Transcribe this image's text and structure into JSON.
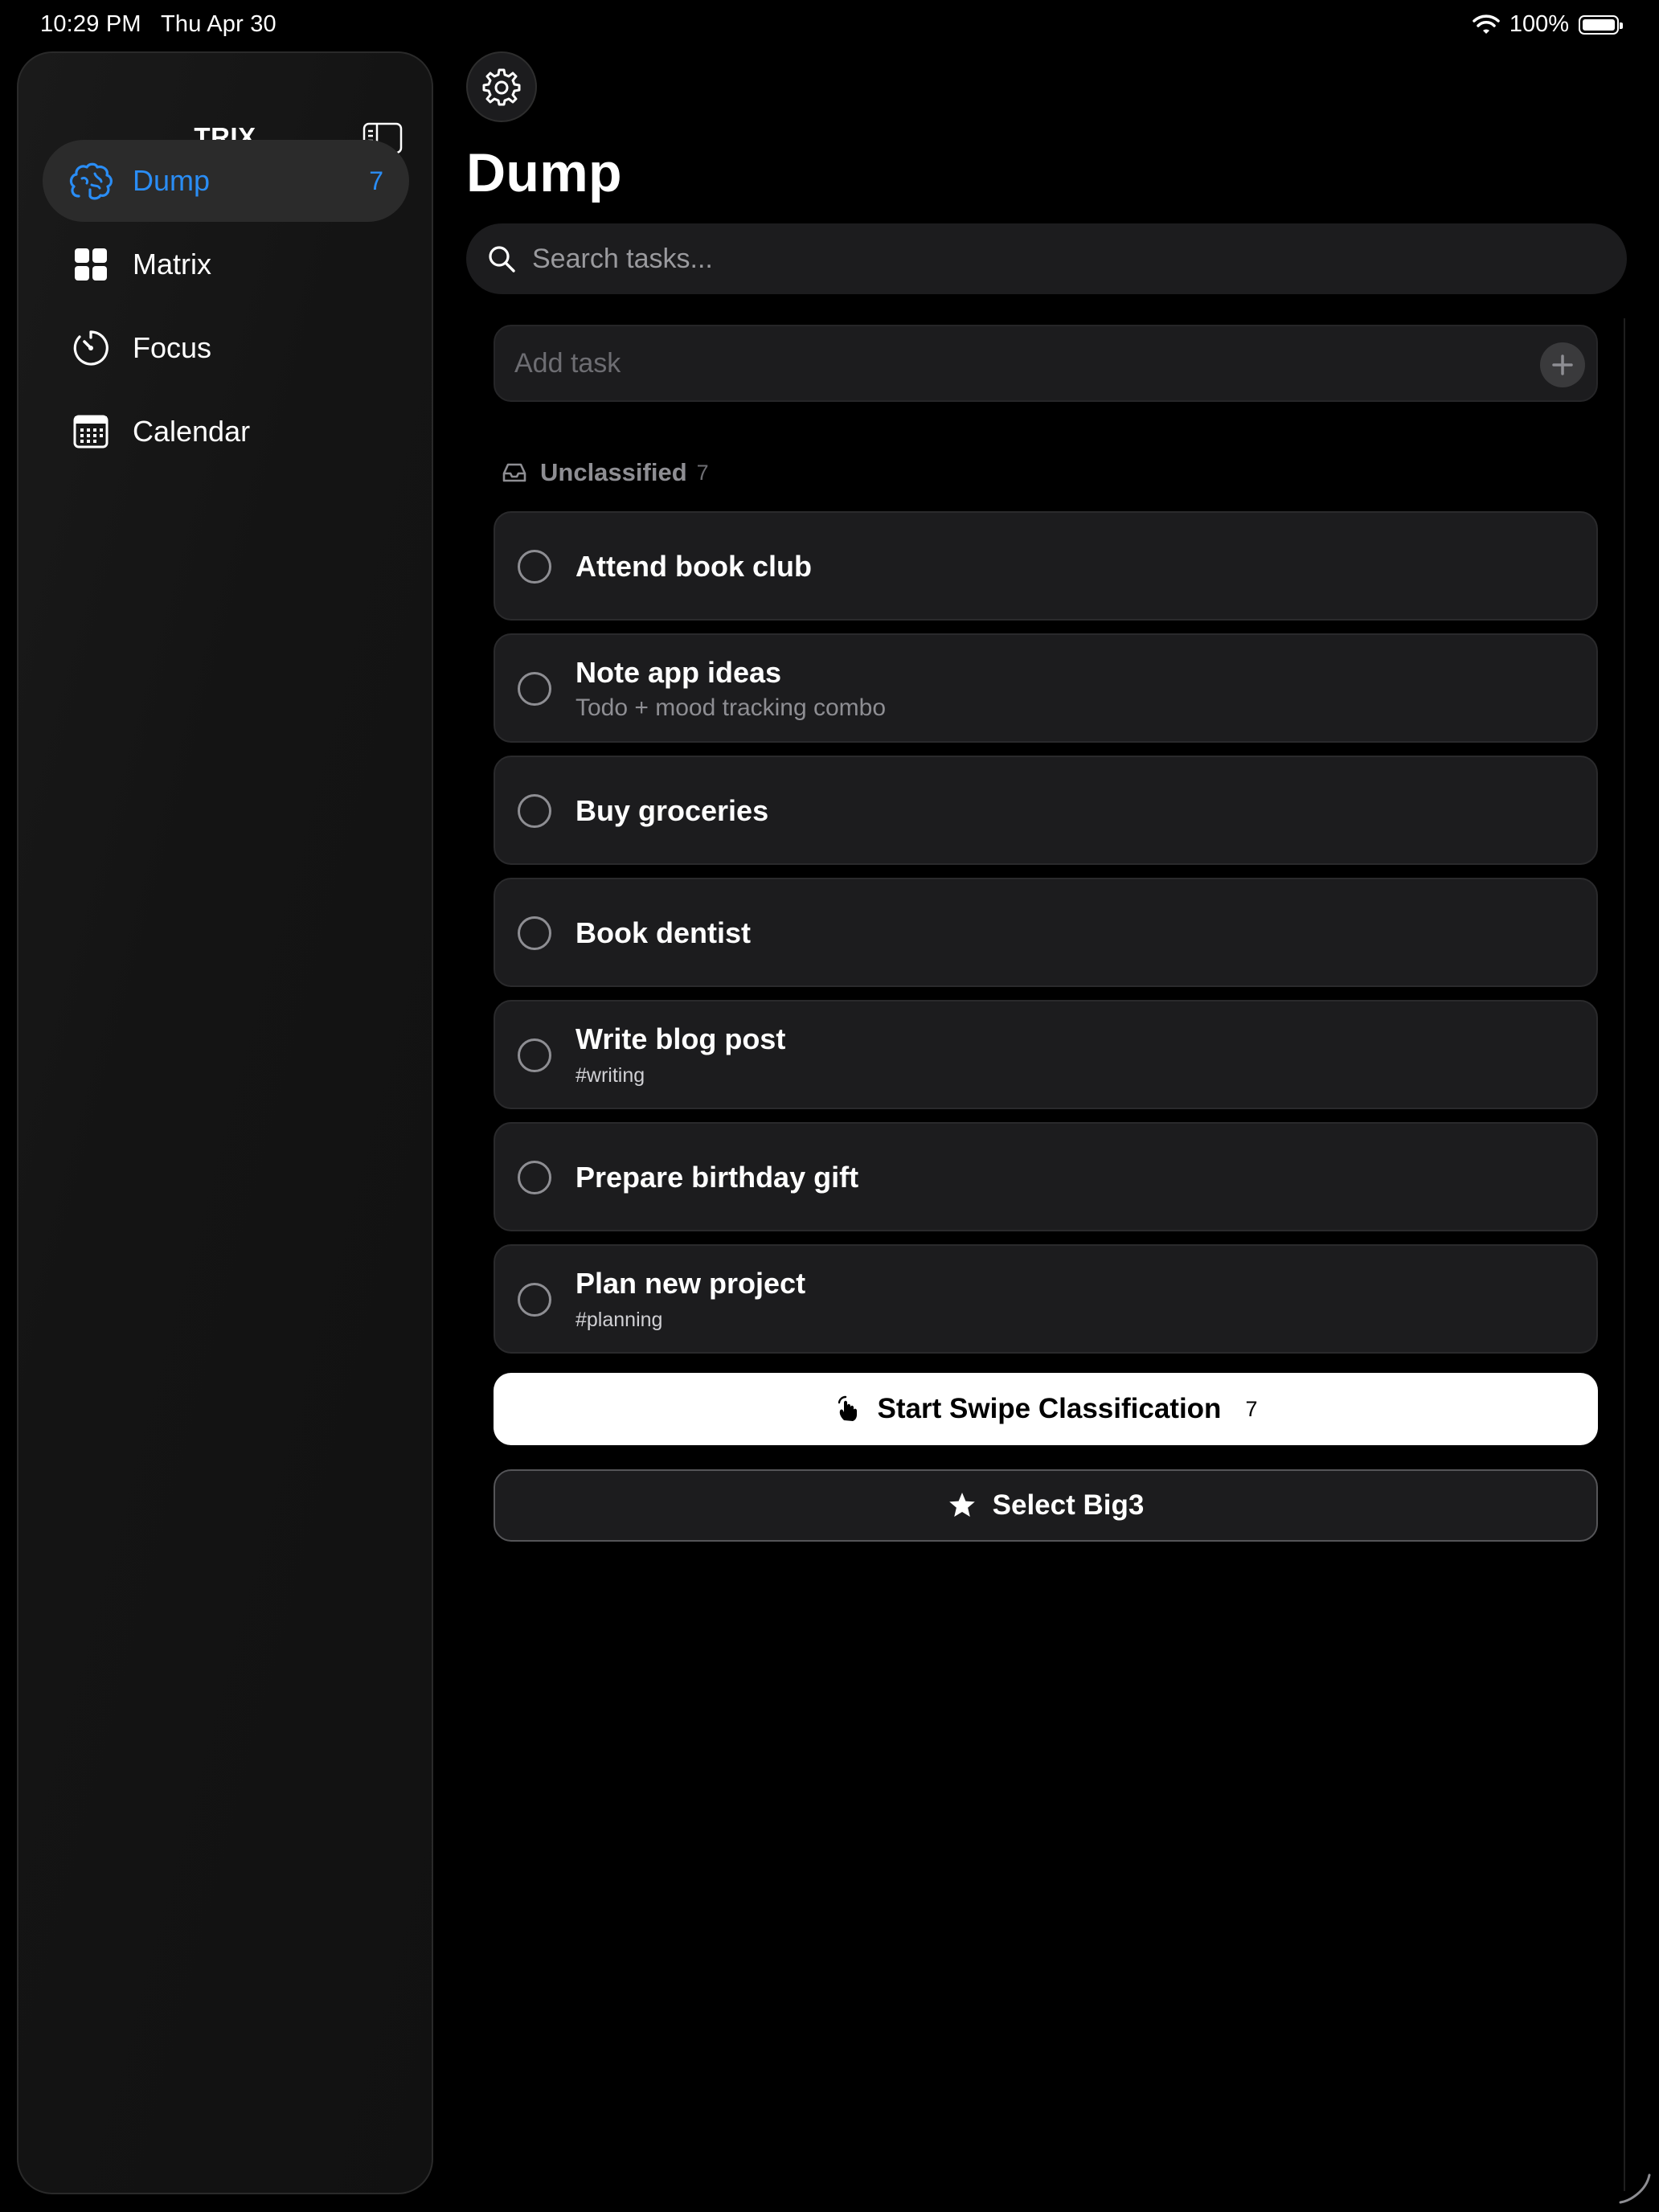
{
  "status_bar": {
    "time": "10:29 PM",
    "date": "Thu Apr 30",
    "battery": "100%"
  },
  "sidebar": {
    "title": "TRIX",
    "items": [
      {
        "label": "Dump",
        "badge": "7",
        "icon": "brain-icon",
        "active": true
      },
      {
        "label": "Matrix",
        "icon": "grid-icon"
      },
      {
        "label": "Focus",
        "icon": "timer-icon"
      },
      {
        "label": "Calendar",
        "icon": "calendar-icon"
      }
    ]
  },
  "main": {
    "title": "Dump",
    "search_placeholder": "Search tasks...",
    "add_task_placeholder": "Add task",
    "section": {
      "title": "Unclassified",
      "count": "7",
      "icon": "tray-icon"
    },
    "tasks": [
      {
        "title": "Attend book club"
      },
      {
        "title": "Note app ideas",
        "subtitle": "Todo + mood tracking combo"
      },
      {
        "title": "Buy groceries"
      },
      {
        "title": "Book dentist"
      },
      {
        "title": "Write blog post",
        "tag": "#writing"
      },
      {
        "title": "Prepare birthday gift"
      },
      {
        "title": "Plan new project",
        "tag": "#planning"
      }
    ],
    "swipe_button": {
      "label": "Start Swipe Classification",
      "count": "7",
      "icon": "hand-tap-icon"
    },
    "big3_button": {
      "label": "Select Big3",
      "icon": "star-icon"
    }
  },
  "colors": {
    "accent": "#2a8df5",
    "background": "#000000",
    "card": "#1c1c1e"
  }
}
